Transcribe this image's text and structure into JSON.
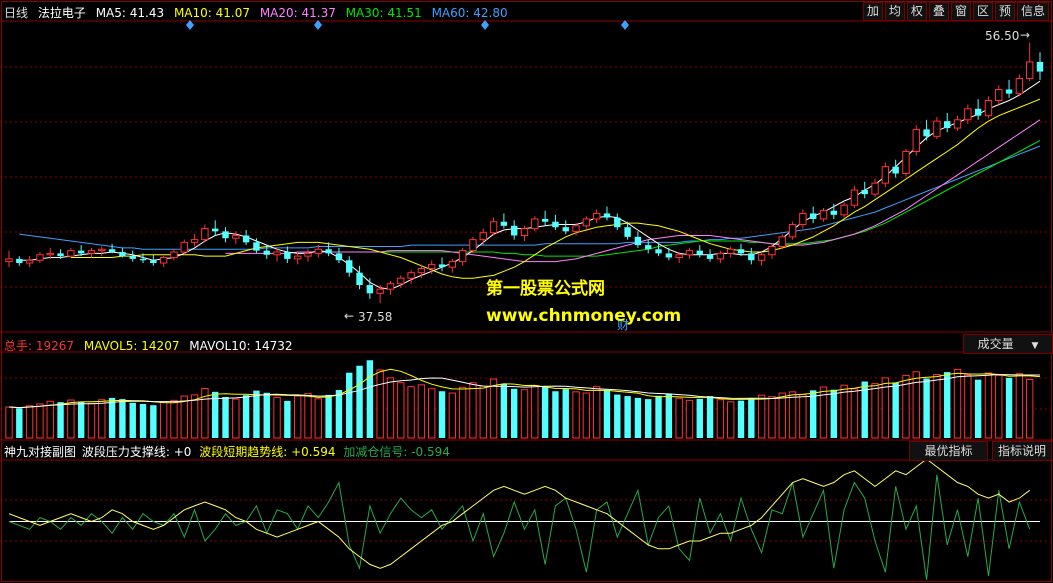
{
  "header": {
    "period": "日线",
    "name": "法拉电子",
    "ma5": "MA5: 41.43",
    "ma10": "MA10: 41.07",
    "ma20": "MA20: 41.37",
    "ma30": "MA30: 41.51",
    "ma60": "MA60: 42.80"
  },
  "toolbar": [
    "加",
    "均",
    "权",
    "叠",
    "窗",
    "区",
    "预",
    "信息"
  ],
  "price_labels": {
    "high": "56.50",
    "low": "37.58",
    "cai": "财"
  },
  "watermark": {
    "line1": "第一股票公式网",
    "line2": "www.chnmoney.com"
  },
  "volume_header": {
    "total": "总手: 19267",
    "mavol5": "MAVOL5: 14207",
    "mavol10": "MAVOL10: 14732",
    "button": "成交量"
  },
  "indicator_header": {
    "name": "神九对接副图",
    "support": "波段压力支撑线: +0",
    "trend": "波段短期趋势线: +0.594",
    "signal": "加减仓信号: -0.594",
    "btn_best": "最优指标",
    "btn_help": "指标说明"
  },
  "colors": {
    "up": "#ff3232",
    "down": "#54ffff",
    "ma5": "#ffffff",
    "ma10": "#ffff00",
    "ma20": "#ff80ff",
    "ma30": "#00e600",
    "ma60": "#3ea0ff",
    "grid": "#8b0000"
  },
  "chart_data": {
    "type": "candlestick",
    "y_min": 36,
    "y_max": 58,
    "ohlc": [
      [
        40.6,
        41.4,
        40.2,
        40.8
      ],
      [
        40.8,
        41.0,
        40.3,
        40.5
      ],
      [
        40.5,
        41.0,
        40.2,
        40.7
      ],
      [
        40.7,
        41.3,
        40.5,
        41.1
      ],
      [
        41.1,
        41.6,
        40.8,
        41.2
      ],
      [
        41.2,
        41.5,
        40.8,
        41.0
      ],
      [
        41.0,
        41.6,
        40.9,
        41.4
      ],
      [
        41.4,
        41.8,
        41.0,
        41.2
      ],
      [
        41.2,
        41.6,
        40.9,
        41.4
      ],
      [
        41.4,
        41.7,
        41.0,
        41.5
      ],
      [
        41.5,
        41.9,
        41.2,
        41.3
      ],
      [
        41.3,
        41.6,
        40.9,
        41.0
      ],
      [
        41.0,
        41.4,
        40.6,
        40.8
      ],
      [
        40.8,
        41.2,
        40.5,
        40.7
      ],
      [
        40.7,
        41.1,
        40.3,
        40.5
      ],
      [
        40.5,
        41.0,
        40.2,
        40.9
      ],
      [
        40.9,
        41.5,
        40.7,
        41.3
      ],
      [
        41.3,
        42.2,
        41.1,
        42.0
      ],
      [
        42.0,
        42.6,
        41.7,
        42.2
      ],
      [
        42.2,
        43.3,
        42.0,
        43.0
      ],
      [
        43.0,
        43.6,
        42.5,
        42.8
      ],
      [
        42.8,
        43.1,
        42.0,
        42.3
      ],
      [
        42.3,
        42.8,
        41.9,
        42.5
      ],
      [
        42.5,
        42.9,
        41.8,
        42.0
      ],
      [
        42.0,
        42.3,
        41.2,
        41.4
      ],
      [
        41.4,
        41.8,
        40.8,
        41.1
      ],
      [
        41.1,
        41.6,
        40.6,
        41.3
      ],
      [
        41.3,
        41.7,
        40.5,
        40.8
      ],
      [
        40.8,
        41.3,
        40.4,
        41.0
      ],
      [
        41.0,
        41.5,
        40.6,
        41.2
      ],
      [
        41.2,
        41.8,
        40.9,
        41.5
      ],
      [
        41.5,
        42.0,
        41.0,
        41.2
      ],
      [
        41.2,
        41.6,
        40.5,
        40.7
      ],
      [
        40.7,
        41.0,
        39.5,
        39.8
      ],
      [
        39.8,
        40.3,
        38.6,
        38.9
      ],
      [
        38.9,
        39.4,
        37.9,
        38.3
      ],
      [
        38.3,
        38.9,
        37.58,
        38.6
      ],
      [
        38.6,
        39.2,
        38.2,
        39.0
      ],
      [
        39.0,
        39.6,
        38.7,
        39.4
      ],
      [
        39.4,
        40.0,
        39.0,
        39.8
      ],
      [
        39.8,
        40.4,
        39.4,
        40.1
      ],
      [
        40.1,
        40.7,
        39.7,
        40.4
      ],
      [
        40.4,
        40.9,
        39.9,
        40.2
      ],
      [
        40.2,
        40.8,
        39.8,
        40.6
      ],
      [
        40.6,
        41.6,
        40.3,
        41.4
      ],
      [
        41.4,
        42.4,
        41.2,
        42.2
      ],
      [
        42.2,
        43.0,
        41.8,
        42.7
      ],
      [
        42.7,
        43.8,
        42.5,
        43.5
      ],
      [
        43.5,
        44.1,
        43.0,
        43.2
      ],
      [
        43.2,
        43.6,
        42.2,
        42.5
      ],
      [
        42.5,
        43.2,
        42.1,
        43.0
      ],
      [
        43.0,
        43.9,
        42.8,
        43.7
      ],
      [
        43.7,
        44.3,
        43.2,
        43.5
      ],
      [
        43.5,
        44.0,
        42.9,
        43.1
      ],
      [
        43.1,
        43.6,
        42.6,
        42.8
      ],
      [
        42.8,
        43.4,
        42.5,
        43.2
      ],
      [
        43.2,
        43.9,
        43.0,
        43.7
      ],
      [
        43.7,
        44.4,
        43.4,
        44.1
      ],
      [
        44.1,
        44.6,
        43.6,
        43.8
      ],
      [
        43.8,
        44.1,
        42.9,
        43.1
      ],
      [
        43.1,
        43.5,
        42.2,
        42.4
      ],
      [
        42.4,
        42.8,
        41.6,
        41.8
      ],
      [
        41.8,
        42.2,
        41.2,
        41.5
      ],
      [
        41.5,
        41.9,
        41.0,
        41.2
      ],
      [
        41.2,
        41.6,
        40.7,
        40.9
      ],
      [
        40.9,
        41.3,
        40.5,
        41.1
      ],
      [
        41.1,
        41.6,
        40.8,
        41.4
      ],
      [
        41.4,
        41.8,
        40.9,
        41.1
      ],
      [
        41.1,
        41.5,
        40.6,
        40.8
      ],
      [
        40.8,
        41.4,
        40.5,
        41.2
      ],
      [
        41.2,
        41.7,
        40.9,
        41.5
      ],
      [
        41.5,
        41.9,
        41.0,
        41.2
      ],
      [
        41.2,
        41.6,
        40.4,
        40.7
      ],
      [
        40.7,
        41.3,
        40.3,
        41.1
      ],
      [
        41.1,
        41.9,
        40.8,
        41.7
      ],
      [
        41.7,
        42.6,
        41.5,
        42.4
      ],
      [
        42.4,
        43.5,
        42.2,
        43.3
      ],
      [
        43.3,
        44.4,
        43.0,
        44.1
      ],
      [
        44.1,
        44.6,
        43.4,
        43.7
      ],
      [
        43.7,
        44.5,
        43.5,
        44.3
      ],
      [
        44.3,
        44.8,
        43.7,
        44.0
      ],
      [
        44.0,
        44.9,
        43.8,
        44.7
      ],
      [
        44.7,
        46.1,
        44.5,
        45.8
      ],
      [
        45.8,
        46.4,
        45.2,
        45.5
      ],
      [
        45.5,
        46.6,
        45.3,
        46.3
      ],
      [
        46.3,
        47.8,
        46.0,
        47.5
      ],
      [
        47.5,
        48.0,
        46.7,
        47.0
      ],
      [
        47.0,
        48.8,
        46.8,
        48.6
      ],
      [
        48.6,
        50.5,
        48.3,
        50.2
      ],
      [
        50.2,
        50.9,
        49.4,
        49.7
      ],
      [
        49.7,
        51.1,
        49.5,
        50.8
      ],
      [
        50.8,
        51.4,
        50.0,
        50.3
      ],
      [
        50.3,
        51.2,
        50.1,
        50.9
      ],
      [
        50.9,
        52.0,
        50.6,
        51.7
      ],
      [
        51.7,
        52.4,
        50.9,
        51.2
      ],
      [
        51.2,
        52.6,
        51.0,
        52.3
      ],
      [
        52.3,
        53.4,
        52.0,
        53.1
      ],
      [
        53.1,
        53.8,
        52.5,
        52.8
      ],
      [
        52.8,
        54.2,
        52.6,
        53.9
      ],
      [
        53.9,
        56.5,
        53.7,
        55.1
      ],
      [
        55.1,
        55.8,
        53.8,
        54.4
      ]
    ],
    "ma5": [
      40.7,
      40.7,
      40.8,
      40.9,
      40.9,
      41.0,
      41.1,
      41.2,
      41.2,
      41.3,
      41.2,
      41.1,
      40.9,
      40.7,
      40.8,
      40.9,
      41.2,
      41.6,
      42.1,
      42.5,
      42.7,
      42.6,
      42.4,
      42.1,
      41.8,
      41.5,
      41.3,
      41.2,
      41.2,
      41.4,
      41.3,
      40.9,
      40.4,
      39.8,
      39.1,
      38.7,
      38.6,
      38.9,
      39.3,
      39.6,
      39.9,
      40.2,
      40.5,
      40.9,
      41.4,
      42.0,
      42.6,
      42.9,
      43.0,
      43.0,
      43.1,
      43.2,
      43.3,
      43.3,
      43.3,
      43.5,
      43.8,
      43.9,
      43.8,
      43.4,
      42.9,
      42.4,
      41.9,
      41.5,
      41.2,
      41.1,
      41.1,
      41.1,
      41.2,
      41.2,
      41.1,
      41.1,
      41.3,
      41.7,
      42.3,
      42.9,
      43.5,
      43.9,
      44.2,
      44.6,
      45.0,
      45.3,
      45.8,
      46.2,
      46.8,
      47.5,
      48.2,
      48.9,
      49.6,
      50.1,
      50.4,
      50.7,
      51.0,
      51.3,
      51.7,
      52.0,
      52.3,
      52.7,
      53.2,
      53.7
    ],
    "ma10": [
      40.9,
      40.9,
      40.9,
      40.9,
      40.9,
      41.0,
      41.0,
      41.1,
      41.1,
      41.1,
      41.1,
      41.1,
      41.1,
      41.0,
      41.0,
      41.0,
      41.2,
      41.4,
      41.6,
      41.7,
      41.8,
      41.9,
      42.0,
      42.0,
      42.0,
      41.9,
      41.8,
      41.7,
      41.6,
      41.5,
      41.3,
      41.1,
      40.9,
      40.6,
      40.3,
      40.0,
      39.7,
      39.5,
      39.4,
      39.4,
      39.5,
      39.6,
      39.9,
      40.2,
      40.6,
      41.1,
      41.6,
      42.0,
      42.4,
      42.7,
      42.9,
      43.1,
      43.2,
      43.3,
      43.4,
      43.4,
      43.3,
      43.2,
      43.0,
      42.8,
      42.5,
      42.2,
      41.9,
      41.7,
      41.5,
      41.4,
      41.3,
      41.3,
      41.4,
      41.6,
      41.8,
      42.1,
      42.4,
      42.8,
      43.2,
      43.7,
      44.2,
      44.6,
      45.1,
      45.6,
      46.1,
      46.6,
      47.1,
      47.6,
      48.1,
      48.6,
      49.1,
      49.7,
      50.3,
      50.8,
      51.2,
      51.5,
      51.8,
      52.1,
      52.4
    ],
    "ma20": [
      41.2,
      41.2,
      41.2,
      41.2,
      41.2,
      41.2,
      41.2,
      41.3,
      41.3,
      41.3,
      41.3,
      41.3,
      41.3,
      41.3,
      41.3,
      41.3,
      41.4,
      41.4,
      41.4,
      41.4,
      41.4,
      41.4,
      41.3,
      41.2,
      41.1,
      41.0,
      40.9,
      40.8,
      40.7,
      40.6,
      40.6,
      40.6,
      40.6,
      40.7,
      40.8,
      41.0,
      41.2,
      41.4,
      41.6,
      41.8,
      42.0,
      42.2,
      42.3,
      42.4,
      42.5,
      42.5,
      42.5,
      42.5,
      42.4,
      42.3,
      42.2,
      42.1,
      42.0,
      41.9,
      41.8,
      41.8,
      41.8,
      41.9,
      42.0,
      42.2,
      42.4,
      42.6,
      42.9,
      43.2,
      43.6,
      44.0,
      44.4,
      44.9,
      45.4,
      45.9,
      46.4,
      46.9,
      47.4,
      47.9,
      48.4,
      48.9,
      49.4,
      49.9,
      50.4,
      50.9
    ],
    "ma30": [
      41.3,
      41.3,
      41.3,
      41.3,
      41.3,
      41.3,
      41.3,
      41.3,
      41.3,
      41.3,
      41.3,
      41.3,
      41.3,
      41.3,
      41.3,
      41.3,
      41.3,
      41.2,
      41.2,
      41.1,
      41.1,
      41.0,
      41.0,
      41.0,
      41.0,
      41.0,
      41.0,
      41.1,
      41.2,
      41.3,
      41.4,
      41.5,
      41.7,
      41.8,
      41.9,
      42.0,
      42.1,
      42.1,
      42.1,
      42.1,
      42.1,
      42.0,
      42.0,
      41.9,
      41.9,
      41.9,
      41.9,
      42.0,
      42.1,
      42.2,
      42.4,
      42.6,
      42.8,
      43.1,
      43.4,
      43.8,
      44.2,
      44.6,
      45.0,
      45.4,
      45.8,
      46.2,
      46.6,
      47.0,
      47.4,
      47.8,
      48.2,
      48.6,
      49.0,
      49.4
    ],
    "ma60": [
      42.6,
      42.5,
      42.4,
      42.3,
      42.2,
      42.1,
      42.0,
      41.9,
      41.8,
      41.7,
      41.6,
      41.6,
      41.5,
      41.5,
      41.5,
      41.5,
      41.5,
      41.5,
      41.5,
      41.5,
      41.5,
      41.5,
      41.5,
      41.5,
      41.6,
      41.6,
      41.6,
      41.6,
      41.6,
      41.7,
      41.7,
      41.7,
      41.7,
      41.7,
      41.7,
      41.7,
      41.7,
      41.7,
      41.8,
      41.8,
      41.8,
      41.8,
      41.8,
      41.8,
      41.8,
      41.8,
      41.8,
      41.8,
      41.8,
      41.8,
      41.8,
      41.9,
      41.9,
      41.9,
      41.9,
      41.9,
      41.9,
      41.9,
      41.9,
      42.0,
      42.0,
      42.0,
      42.0,
      42.0,
      42.0,
      42.1,
      42.1,
      42.2,
      42.2,
      42.3,
      42.3,
      42.4,
      42.5,
      42.6,
      42.7,
      42.8,
      42.9,
      43.0,
      43.2,
      43.4,
      43.6,
      43.8,
      44.0,
      44.2,
      44.5,
      44.8,
      45.1,
      45.4,
      45.7,
      46.0,
      46.3,
      46.6,
      46.9,
      47.2,
      47.5,
      47.8,
      48.1,
      48.4,
      48.7,
      49.0
    ],
    "volume": [
      10200,
      9800,
      10600,
      11200,
      12100,
      11800,
      12500,
      11900,
      11400,
      12600,
      13200,
      12800,
      11600,
      11200,
      10800,
      11900,
      12400,
      13800,
      14200,
      16300,
      15200,
      13500,
      12800,
      14100,
      15600,
      14900,
      13400,
      12200,
      13800,
      14600,
      12900,
      14200,
      15800,
      21500,
      23800,
      25600,
      22400,
      19800,
      18200,
      16900,
      17500,
      16200,
      15400,
      14800,
      16700,
      18200,
      17100,
      19400,
      17800,
      16200,
      15900,
      17300,
      16800,
      15400,
      16100,
      15200,
      14800,
      16900,
      15600,
      14300,
      13800,
      13200,
      12800,
      13900,
      14600,
      13100,
      12400,
      12900,
      13800,
      12600,
      11900,
      12300,
      13200,
      14100,
      13600,
      14800,
      15200,
      14300,
      15700,
      16800,
      15900,
      17400,
      16200,
      18600,
      17900,
      19800,
      18200,
      20600,
      21800,
      19600,
      20900,
      21700,
      22600,
      20800,
      19200,
      21400,
      20600,
      19800,
      21200,
      19267
    ],
    "indicator_range": [
      -1.5,
      1.5
    ],
    "indicator_trend": [
      0.2,
      0.1,
      0.0,
      -0.1,
      0.0,
      0.1,
      0.2,
      0.1,
      0.0,
      0.1,
      0.3,
      0.2,
      0.0,
      -0.1,
      -0.2,
      -0.1,
      0.1,
      0.3,
      0.4,
      0.5,
      0.4,
      0.3,
      0.1,
      0.0,
      -0.2,
      -0.3,
      -0.4,
      -0.3,
      -0.2,
      -0.1,
      0.0,
      -0.2,
      -0.4,
      -0.7,
      -0.9,
      -1.1,
      -1.2,
      -1.1,
      -0.9,
      -0.7,
      -0.5,
      -0.3,
      -0.1,
      0.0,
      0.2,
      0.4,
      0.6,
      0.8,
      0.9,
      0.8,
      0.7,
      0.8,
      0.9,
      0.8,
      0.6,
      0.5,
      0.4,
      0.3,
      0.2,
      0.0,
      -0.2,
      -0.4,
      -0.6,
      -0.7,
      -0.7,
      -0.6,
      -0.5,
      -0.5,
      -0.4,
      -0.3,
      -0.3,
      -0.2,
      -0.1,
      0.1,
      0.4,
      0.7,
      1.0,
      1.1,
      1.0,
      0.9,
      1.0,
      1.2,
      1.3,
      1.1,
      0.9,
      1.1,
      1.3,
      1.2,
      1.4,
      1.6,
      1.4,
      1.2,
      1.0,
      0.9,
      0.7,
      0.6,
      0.7,
      0.5,
      0.6,
      0.8
    ],
    "indicator_signal": [
      0.0,
      -0.1,
      -0.2,
      0.1,
      0.0,
      -0.2,
      0.1,
      -0.1,
      0.2,
      0.0,
      -0.3,
      0.1,
      -0.2,
      0.2,
      0.0,
      -0.1,
      0.2,
      -0.4,
      0.3,
      -0.5,
      -0.2,
      0.2,
      -0.1,
      0.0,
      0.4,
      -0.3,
      0.3,
      0.2,
      -0.2,
      0.4,
      0.1,
      0.5,
      1.0,
      -0.6,
      -1.2,
      0.4,
      -0.3,
      0.2,
      0.6,
      0.3,
      0.1,
      0.3,
      -0.2,
      0.1,
      0.4,
      -0.5,
      0.2,
      -0.9,
      -0.3,
      0.5,
      -0.2,
      0.3,
      -1.1,
      0.4,
      0.6,
      -0.2,
      -1.3,
      0.3,
      0.5,
      -0.4,
      0.2,
      0.8,
      -0.6,
      0.1,
      0.4,
      -0.7,
      -1.0,
      0.6,
      -0.3,
      0.2,
      -0.5,
      0.6,
      -0.2,
      -0.8,
      0.3,
      0.2,
      1.0,
      -0.4,
      0.2,
      0.8,
      -1.2,
      0.3,
      1.0,
      0.6,
      -0.5,
      -1.3,
      0.9,
      -0.2,
      0.4,
      -1.5,
      1.2,
      -0.6,
      0.3,
      -0.9,
      0.6,
      -1.4,
      0.8,
      -0.7,
      0.5,
      -0.2
    ]
  }
}
